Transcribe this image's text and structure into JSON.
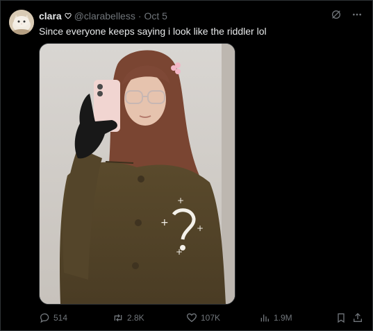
{
  "author": {
    "display_name": "clara",
    "handle": "@clarabelless",
    "separator": "·",
    "date": "Oct 5"
  },
  "tweet": {
    "text": "Since everyone keeps saying i look like the riddler lol"
  },
  "actions": {
    "replies": "514",
    "reposts": "2.8K",
    "likes": "107K",
    "views": "1.9M"
  },
  "icons": {
    "heart": "heart-outline-icon",
    "grok": "grok-icon",
    "more": "more-dots-icon",
    "reply": "reply-icon",
    "repost": "repost-icon",
    "like": "like-heart-icon",
    "views": "views-bar-chart-icon",
    "bookmark": "bookmark-icon",
    "share": "share-icon"
  },
  "colors": {
    "background": "#000000",
    "text": "#e7e9ea",
    "muted": "#71767b",
    "border": "#2f3336"
  }
}
